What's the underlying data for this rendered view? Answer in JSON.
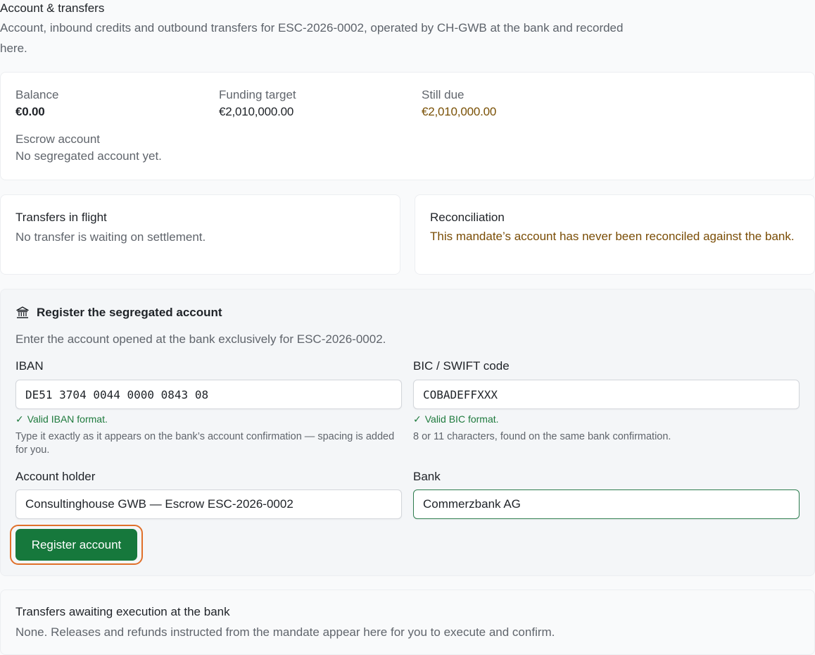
{
  "header": {
    "title": "Account & transfers",
    "description": "Account, inbound credits and outbound transfers for ESC-2026-0002, operated by CH-GWB at the bank and recorded here."
  },
  "summary": {
    "balance_label": "Balance",
    "balance_value": "€0.00",
    "funding_target_label": "Funding target",
    "funding_target_value": "€2,010,000.00",
    "still_due_label": "Still due",
    "still_due_value": "€2,010,000.00",
    "escrow_label": "Escrow account",
    "escrow_value": "No segregated account yet."
  },
  "transfers_in_flight": {
    "title": "Transfers in flight",
    "text": "No transfer is waiting on settlement."
  },
  "reconciliation": {
    "title": "Reconciliation",
    "text": "This mandate’s account has never been reconciled against the bank."
  },
  "register": {
    "icon": "bank-icon",
    "title": "Register the segregated account",
    "description": "Enter the account opened at the bank exclusively for ESC-2026-0002.",
    "iban": {
      "label": "IBAN",
      "value": "DE51 3704 0044 0000 0843 08",
      "valid": "Valid IBAN format.",
      "hint": "Type it exactly as it appears on the bank’s account confirmation — spacing is added for you."
    },
    "bic": {
      "label": "BIC / SWIFT code",
      "value": "COBADEFFXXX",
      "valid": "Valid BIC format.",
      "hint": "8 or 11 characters, found on the same bank confirmation."
    },
    "holder": {
      "label": "Account holder",
      "value": "Consultinghouse GWB — Escrow ESC-2026-0002"
    },
    "bank": {
      "label": "Bank",
      "value": "Commerzbank AG"
    },
    "button_label": "Register account"
  },
  "awaiting": {
    "title": "Transfers awaiting execution at the bank",
    "text": "None. Releases and refunds instructed from the mandate appear here for you to execute and confirm."
  },
  "colors": {
    "primary_button": "#16783c",
    "focus_ring": "#e0702a",
    "valid_text": "#1e7a3d",
    "warning_text": "#7a4d06"
  }
}
